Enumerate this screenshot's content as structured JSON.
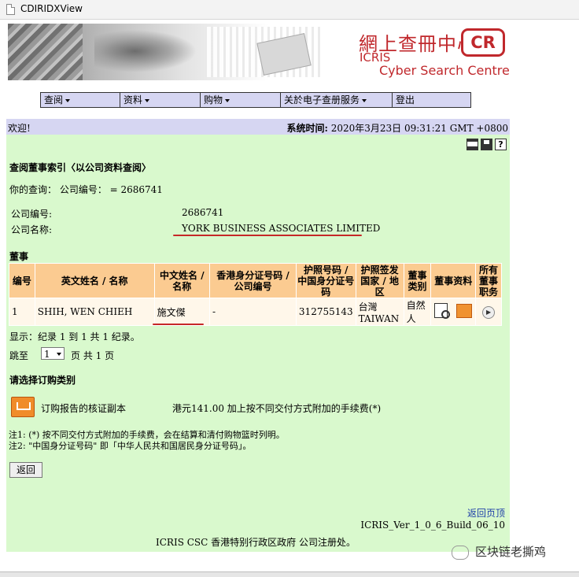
{
  "window": {
    "title": "CDIRIDXView"
  },
  "banner": {
    "zh_title": "網上查冊中心",
    "logo_text": "CR",
    "en_line1": "ICRIS",
    "en_line2": "Cyber Search Centre"
  },
  "menu": [
    {
      "label": "查阅"
    },
    {
      "label": "资料"
    },
    {
      "label": "购物"
    },
    {
      "label": "关於电子查册服务"
    },
    {
      "label": "登出"
    }
  ],
  "header": {
    "welcome": "欢迎!",
    "systime_label": "系统时间:",
    "systime_value": "2020年3月23日 09:31:21 GMT +0800"
  },
  "icons": [
    "print-icon",
    "save-icon",
    "help-icon"
  ],
  "page": {
    "heading": "查阅董事索引〈以公司资料查阅〉",
    "query": "你的查询： 公司编号： = 2686741",
    "company_no_label": "公司编号:",
    "company_no_value": "2686741",
    "company_name_label": "公司名称:",
    "company_name_value": "YORK BUSINESS ASSOCIATES LIMITED",
    "section_directors": "董事"
  },
  "directors_table": {
    "headers": [
      "编号",
      "英文姓名 / 名称",
      "中文姓名 / 名称",
      "香港身分证号码 / 公司编号",
      "护照号码 / 中国身分证号码",
      "护照签发国家 / 地区",
      "董事类别",
      "董事资料",
      "所有董事职务"
    ],
    "rows": [
      {
        "no": "1",
        "english_name": "SHIH, WEN CHIEH",
        "chinese_name": "施文傑",
        "hkid": "-",
        "passport": "312755143",
        "country_zh": "台灣",
        "country_en": "TAIWAN",
        "category": "自然人"
      }
    ]
  },
  "pagination": {
    "display": "显示：纪录 1 到 1 共 1 纪录。",
    "jump_label": "跳至",
    "page_select": "1",
    "page_suffix": "页 共 1 页"
  },
  "order": {
    "title": "请选择订购类别",
    "item_label": "订购报告的核证副本",
    "item_price": "港元141.00 加上按不同交付方式附加的手续费(*)"
  },
  "notes": {
    "note1": "注1: (*) 按不同交付方式附加的手续费，会在结算和清付购物篮时列明。",
    "note2": "注2: \"中国身分证号码\" 即「中华人民共和国居民身分证号码」。"
  },
  "buttons": {
    "back": "返回"
  },
  "footer": {
    "back_to_top": "返回页顶",
    "version": "ICRIS_Ver_1_0_6_Build_06_10",
    "credit": "ICRIS CSC 香港特别行政区政府 公司注册处。"
  },
  "watermark": {
    "text": "区块链老撕鸡"
  },
  "colors": {
    "content_bg": "#d9f9cd",
    "header_strip": "#d6d6f2",
    "table_header": "#fbcb91",
    "table_row": "#fff7ea",
    "annotation_red": "#c62828",
    "link_blue": "#1e3fa8"
  }
}
